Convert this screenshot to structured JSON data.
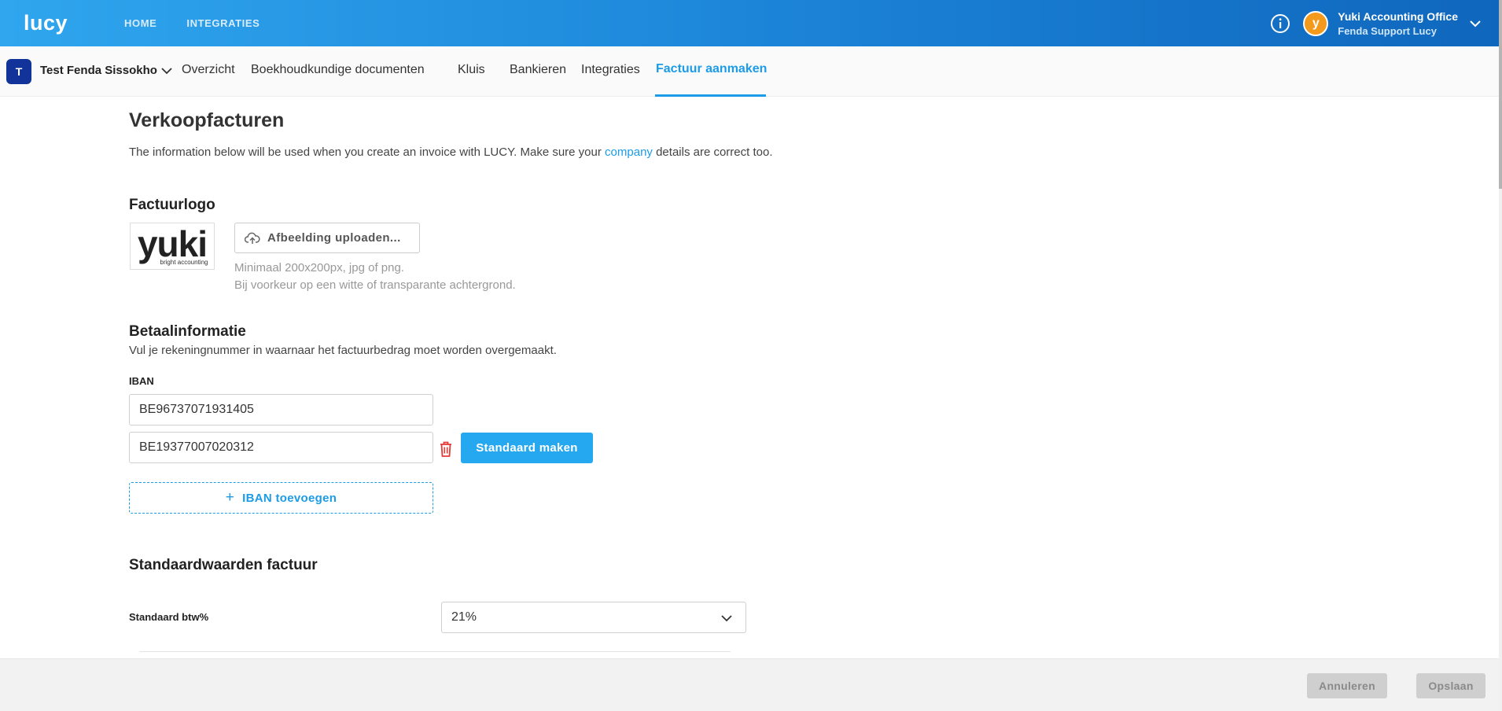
{
  "app": {
    "logo": "lucy",
    "nav": [
      "HOME",
      "INTEGRATIES"
    ],
    "user": {
      "avatar_initial": "y",
      "name": "Yuki Accounting Office",
      "subtitle": "Fenda Support Lucy"
    }
  },
  "client": {
    "initial": "T",
    "name": "Test Fenda Sissokho"
  },
  "tabs": [
    {
      "label": "Overzicht",
      "active": false
    },
    {
      "label": "Boekhoudkundige documenten",
      "active": false
    },
    {
      "label": "Kluis",
      "active": false
    },
    {
      "label": "Bankieren",
      "active": false
    },
    {
      "label": "Integraties",
      "active": false
    },
    {
      "label": "Factuur aanmaken",
      "active": true
    }
  ],
  "page": {
    "title": "Verkoopfacturen",
    "intro_before": "The information below will be used when you create an invoice with LUCY. Make sure your ",
    "intro_link": "company",
    "intro_after": " details are correct too."
  },
  "logo_section": {
    "title": "Factuurlogo",
    "logo_text": "yuki",
    "logo_subtext": "bright accounting",
    "upload_label": "Afbeelding uploaden...",
    "hint_1": "Minimaal 200x200px, jpg of png.",
    "hint_2": "Bij voorkeur op een witte of transparante achtergrond."
  },
  "payment": {
    "title": "Betaalinformatie",
    "subtitle": "Vul je rekeningnummer in waarnaar het factuurbedrag moet worden overgemaakt.",
    "iban_label": "IBAN",
    "ibans": [
      "BE96737071931405",
      "BE19377007020312"
    ],
    "make_default_label": "Standaard maken",
    "add_iban_label": "IBAN toevoegen"
  },
  "defaults": {
    "title": "Standaardwaarden factuur",
    "vat_label": "Standaard btw%",
    "vat_value": "21%"
  },
  "footer": {
    "cancel_label": "Annuleren",
    "save_label": "Opslaan"
  },
  "colors": {
    "accent": "#1c9be6",
    "primary_button": "#26a8f0",
    "danger": "#e53935",
    "client_badge": "#11339a",
    "avatar": "#f39a1d"
  }
}
